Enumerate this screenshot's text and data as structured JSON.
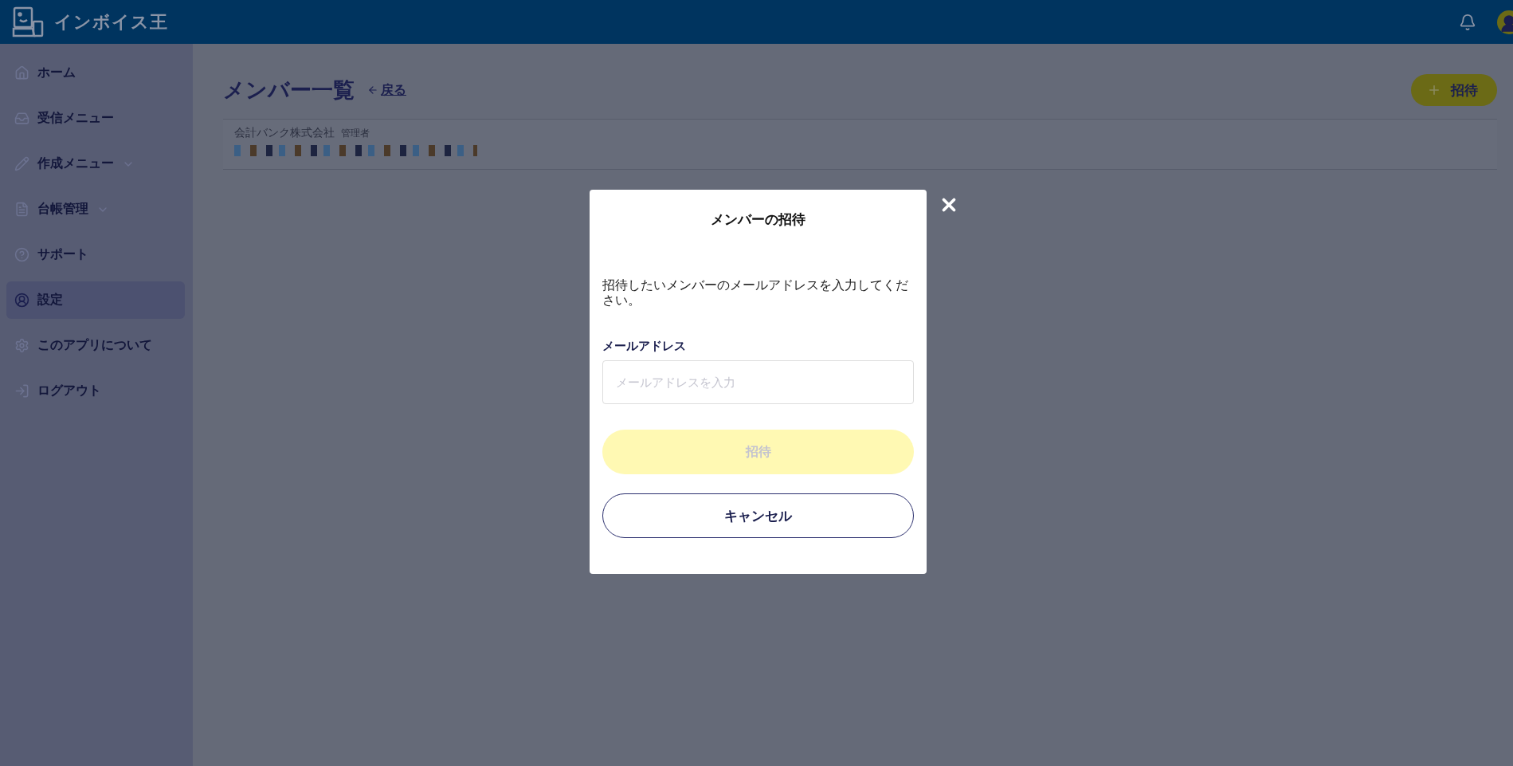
{
  "app": {
    "title": "インボイス王"
  },
  "sidebar": {
    "items": [
      {
        "label": "ホーム",
        "kind": "link",
        "selected": false
      },
      {
        "label": "受信メニュー",
        "kind": "link",
        "selected": false
      },
      {
        "label": "作成メニュー",
        "kind": "expandable",
        "expanded": false,
        "selected": false
      },
      {
        "label": "台帳管理",
        "kind": "expandable",
        "expanded": false,
        "selected": false
      },
      {
        "label": "サポート",
        "kind": "link",
        "selected": false
      },
      {
        "label": "設定",
        "kind": "link",
        "selected": true
      },
      {
        "label": "このアプリについて",
        "kind": "link",
        "selected": false
      },
      {
        "label": "ログアウト",
        "kind": "link",
        "selected": false
      }
    ]
  },
  "page": {
    "title": "メンバー一覧",
    "back_link": "戻る",
    "invite_button": "招待",
    "members": [
      {
        "company": "会計バンク株式会社",
        "role": "管理者"
      }
    ]
  },
  "modal": {
    "title": "メンバーの招待",
    "message": "招待したいメンバーのメールアドレスを入力してください。",
    "field_label": "メールアドレス",
    "placeholder": "メールアドレスを入力",
    "submit": {
      "label": "招待",
      "disabled": true
    },
    "cancel": "キャンセル"
  }
}
